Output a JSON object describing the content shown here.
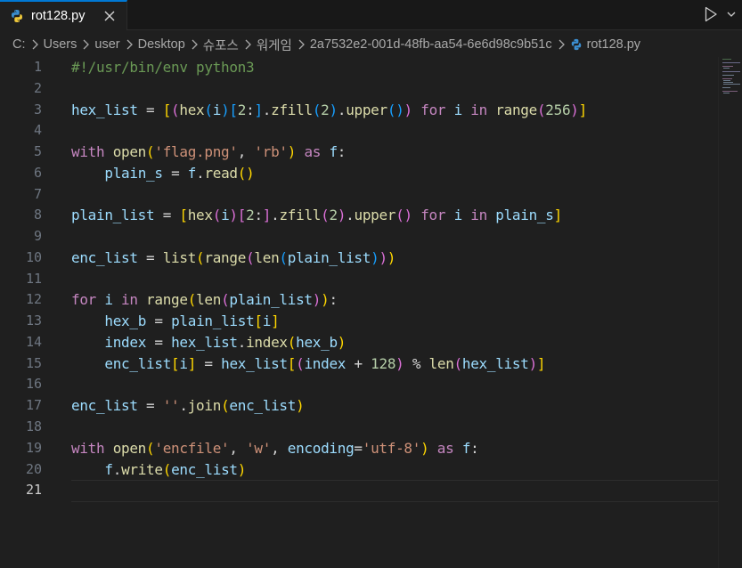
{
  "tab": {
    "title": "rot128.py",
    "close_glyph": "✕"
  },
  "toolbar": {
    "run_icon": "run-icon",
    "more_icon": "more-icon"
  },
  "breadcrumb": {
    "items": [
      "C:",
      "Users",
      "user",
      "Desktop",
      "슈포스",
      "워게임",
      "2a7532e2-001d-48fb-aa54-6e6d98c9b51c",
      "rot128.py"
    ]
  },
  "editor": {
    "active_line": 21,
    "line_numbers": [
      "1",
      "2",
      "3",
      "4",
      "5",
      "6",
      "7",
      "8",
      "9",
      "10",
      "11",
      "12",
      "13",
      "14",
      "15",
      "16",
      "17",
      "18",
      "19",
      "20",
      "21"
    ],
    "lines": [
      "#!/usr/bin/env python3",
      "",
      "hex_list = [(hex(i)[2:].zfill(2).upper()) for i in range(256)]",
      "",
      "with open('flag.png', 'rb') as f:",
      "    plain_s = f.read()",
      "",
      "plain_list = [hex(i)[2:].zfill(2).upper() for i in plain_s]",
      "",
      "enc_list = list(range(len(plain_list)))",
      "",
      "for i in range(len(plain_list)):",
      "    hex_b = plain_list[i]",
      "    index = hex_list.index(hex_b)",
      "    enc_list[i] = hex_list[(index + 128) % len(hex_list)]",
      "",
      "enc_list = ''.join(enc_list)",
      "",
      "with open('encfile', 'w', encoding='utf-8') as f:",
      "    f.write(enc_list)",
      ""
    ]
  },
  "colors": {
    "accent": "#0078d4",
    "background": "#1f1f1f",
    "keyword": "#c586c0",
    "variable": "#9cdcfe",
    "function": "#dcdcaa",
    "builtin": "#4ec9b0",
    "string": "#ce9178",
    "number": "#b5cea8",
    "comment": "#6a9955"
  }
}
